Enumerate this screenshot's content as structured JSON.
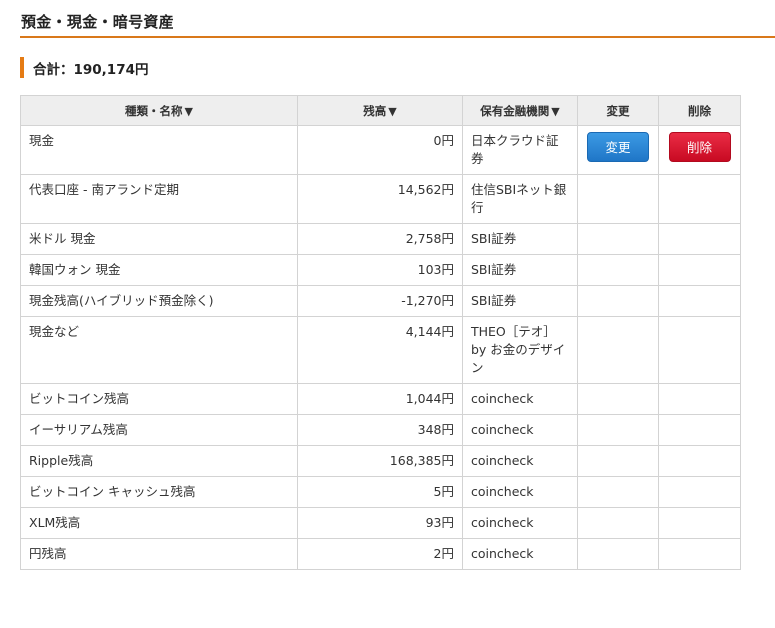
{
  "section": {
    "title": "預金・現金・暗号資産"
  },
  "total": {
    "text": "合計：190,174円"
  },
  "table": {
    "columns": {
      "name": "種類・名称",
      "balance": "残高",
      "institution": "保有金融機関",
      "edit": "変更",
      "delete": "削除"
    },
    "sort_arrow": "▼",
    "buttons": {
      "edit": "変更",
      "delete": "削除"
    },
    "rows": [
      {
        "name": "現金",
        "amount": "0円",
        "institution": "日本クラウド証券",
        "has_actions": true
      },
      {
        "name": "代表口座 - 南アランド定期",
        "amount": "14,562円",
        "institution": "住信SBIネット銀行"
      },
      {
        "name": "米ドル 現金",
        "amount": "2,758円",
        "institution": "SBI証券"
      },
      {
        "name": "韓国ウォン 現金",
        "amount": "103円",
        "institution": "SBI証券"
      },
      {
        "name": "現金残高(ハイブリッド預金除く)",
        "amount": "-1,270円",
        "institution": "SBI証券"
      },
      {
        "name": "現金など",
        "amount": "4,144円",
        "institution": "THEO［テオ］ by お金のデザイン"
      },
      {
        "name": "ビットコイン残高",
        "amount": "1,044円",
        "institution": "coincheck"
      },
      {
        "name": "イーサリアム残高",
        "amount": "348円",
        "institution": "coincheck"
      },
      {
        "name": "Ripple残高",
        "amount": "168,385円",
        "institution": "coincheck"
      },
      {
        "name": "ビットコイン キャッシュ残高",
        "amount": "5円",
        "institution": "coincheck"
      },
      {
        "name": "XLM残高",
        "amount": "93円",
        "institution": "coincheck"
      },
      {
        "name": "円残高",
        "amount": "2円",
        "institution": "coincheck"
      }
    ]
  },
  "colors": {
    "accent": "#e57b14",
    "edit_button": "#2a85d6",
    "delete_button": "#d8112c",
    "header_bg": "#eeeeee",
    "border": "#d3d3d3"
  }
}
